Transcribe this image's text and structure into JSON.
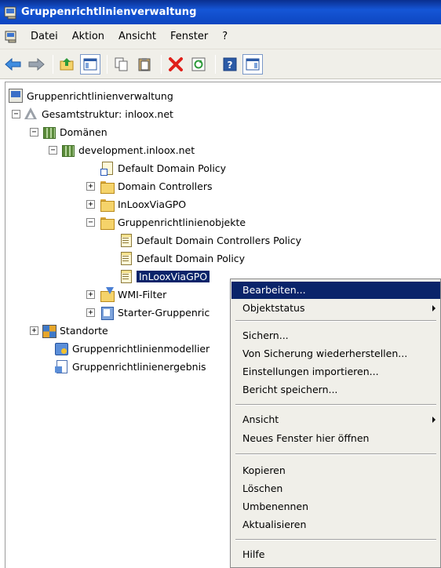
{
  "window": {
    "title": "Gruppenrichtlinienverwaltung"
  },
  "menubar": {
    "items": [
      "Datei",
      "Aktion",
      "Ansicht",
      "Fenster",
      "?"
    ]
  },
  "toolbar": {
    "buttons": [
      "back-icon",
      "forward-icon",
      "up-folder-icon",
      "show-hide-console-tree-icon",
      "copy-icon",
      "paste-icon",
      "delete-icon",
      "refresh-icon",
      "help-icon",
      "properties-pane-icon"
    ]
  },
  "tree": {
    "root": "Gruppenrichtlinienverwaltung",
    "forest": "Gesamtstruktur: inloox.net",
    "domains": "Domänen",
    "domain": "development.inloox.net",
    "default_domain_policy_link": "Default Domain Policy",
    "domain_controllers": "Domain Controllers",
    "inloox_via_gpo_ou": "InLooxViaGPO",
    "gpo_container": "Gruppenrichtlinienobjekte",
    "gpo_default_dc_policy": "Default Domain Controllers Policy",
    "gpo_default_domain_policy": "Default Domain Policy",
    "gpo_inloox": "InLooxViaGPO",
    "wmi_filter": "WMI-Filter",
    "starter": "Starter-Gruppenric",
    "sites": "Standorte",
    "modeling": "Gruppenrichtlinienmodellier",
    "results": "Gruppenrichtlinienergebnis"
  },
  "context_menu": {
    "items": [
      "Bearbeiten...",
      "Objektstatus",
      "Sichern...",
      "Von Sicherung wiederherstellen...",
      "Einstellungen importieren...",
      "Bericht speichern...",
      "Ansicht",
      "Neues Fenster hier öffnen",
      "Kopieren",
      "Löschen",
      "Umbenennen",
      "Aktualisieren",
      "Hilfe"
    ],
    "highlighted": "Bearbeiten..."
  },
  "colors": {
    "title_bar": "#0d45c0",
    "selection": "#0a246a",
    "menu_background": "#f0efe9"
  }
}
